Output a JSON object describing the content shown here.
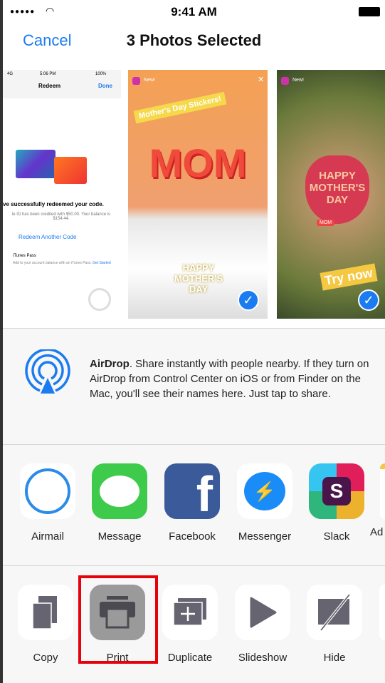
{
  "status": {
    "time": "9:41 AM"
  },
  "nav": {
    "cancel": "Cancel",
    "title": "3 Photos Selected"
  },
  "photos": [
    {
      "status_carrier": "4G",
      "status_time": "5:06 PM",
      "status_battery": "100%",
      "title": "Redeem",
      "done": "Done",
      "success": "ve successfully redeemed your code.",
      "credit": "le ID has been credited with $50.00. Your balance is $154.44.",
      "redeem_another": "Redeem Another Code",
      "itunes_pass": "iTunes Pass",
      "itunes_desc": "Add to your account balance with an iTunes Pass.",
      "get_started": "Get Started",
      "selected": false
    },
    {
      "badge": "New!",
      "sticker": "Mother's Day Stickers!",
      "mom": "MOM",
      "happy": "HAPPY MOTHER'S DAY",
      "selected": true
    },
    {
      "badge": "New!",
      "heart": "HAPPY MOTHER'S DAY",
      "mom_tag": "MOM",
      "try_now": "Try now",
      "selected": true
    }
  ],
  "airdrop": {
    "title": "AirDrop",
    "text": ". Share instantly with people nearby. If they turn on AirDrop from Control Center on iOS or from Finder on the Mac, you'll see their names here. Just tap to share."
  },
  "apps": [
    {
      "label": "Airmail",
      "icon": "airmail-icon"
    },
    {
      "label": "Message",
      "icon": "message-icon"
    },
    {
      "label": "Facebook",
      "icon": "facebook-icon"
    },
    {
      "label": "Messenger",
      "icon": "messenger-icon"
    },
    {
      "label": "Slack",
      "icon": "slack-icon"
    },
    {
      "label": "Ad",
      "icon": "notes-icon"
    }
  ],
  "actions": [
    {
      "label": "Copy",
      "icon": "copy-icon"
    },
    {
      "label": "Print",
      "icon": "print-icon",
      "highlighted": true
    },
    {
      "label": "Duplicate",
      "icon": "duplicate-icon"
    },
    {
      "label": "Slideshow",
      "icon": "slideshow-icon"
    },
    {
      "label": "Hide",
      "icon": "hide-icon"
    }
  ],
  "colors": {
    "accent": "#1a7cf0",
    "highlight": "#e8000b"
  }
}
